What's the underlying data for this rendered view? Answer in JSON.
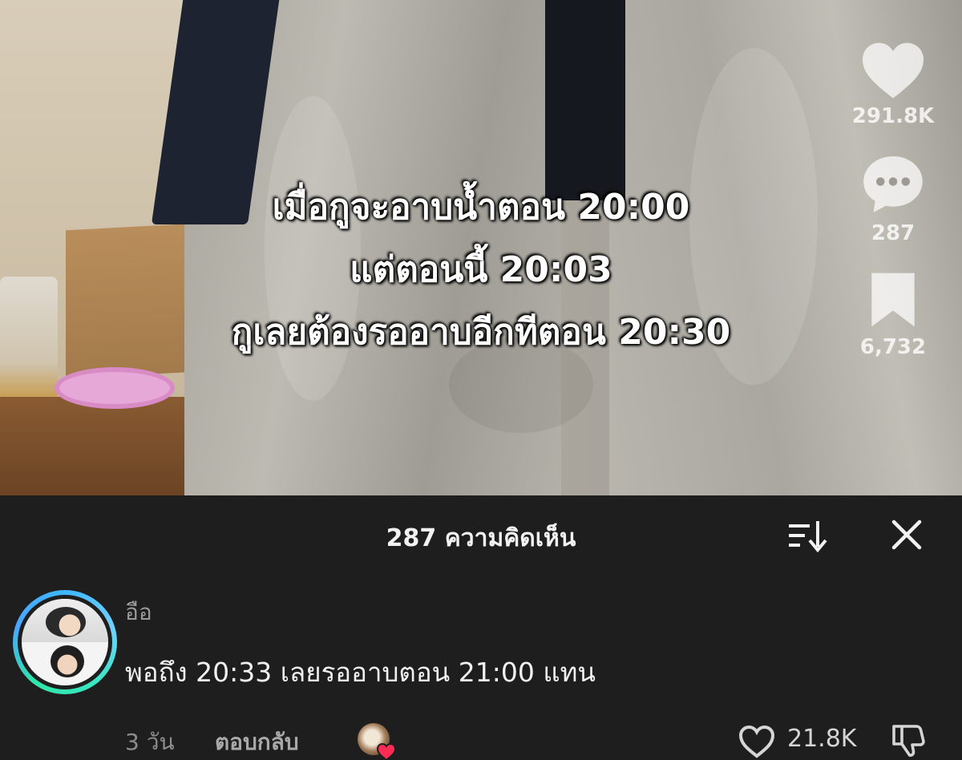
{
  "video": {
    "caption_lines": [
      "เมื่อกูจะอาบน้ำตอน 20:00",
      "แต่ตอนนี้ 20:03",
      "กูเลยต้องรออาบอีกทีตอน 20:30"
    ]
  },
  "side_actions": {
    "likes": "291.8K",
    "comments": "287",
    "saves": "6,732"
  },
  "comments_sheet": {
    "title": "287 ความคิดเห็น",
    "sort_icon": "sort-icon",
    "close_icon": "close-icon",
    "comment": {
      "username": "อือ",
      "text": "พอถึง 20:33 เลยรออาบตอน 21:00 แทน",
      "time_ago": "3 วัน",
      "reply_label": "ตอบกลับ",
      "like_count": "21.8K",
      "liked_by_creator": true
    }
  },
  "colors": {
    "sheet_bg": "#1e1e1e",
    "creator_heart": "#fe2c55",
    "avatar_ring": "#3fb6ff"
  }
}
